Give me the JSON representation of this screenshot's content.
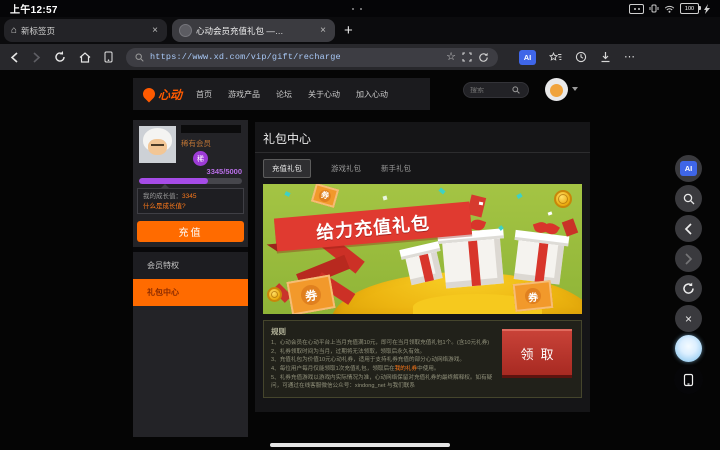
{
  "status_bar": {
    "time": "上午12:57",
    "battery": "100"
  },
  "browser": {
    "tabs": [
      {
        "title": "新标签页"
      },
      {
        "title": "心动会员充值礼包 —…"
      }
    ],
    "new_tab_label": "+",
    "url": "https://www.xd.com/vip/gift/recharge",
    "ai_label": "AI"
  },
  "site": {
    "nav": {
      "logo_text": "心动",
      "menu": [
        "首页",
        "游戏产品",
        "论坛",
        "关于心动",
        "加入心动"
      ],
      "search_placeholder": "搜索"
    },
    "sidebar": {
      "member_level": "稀有会员",
      "badge_char": "稀",
      "progress_text": "3345/5000",
      "growth_label": "我的成长值：",
      "growth_value": "3345",
      "growth_link": "什么是成长值?",
      "recharge_button": "充值",
      "menu": [
        {
          "label": "会员特权"
        },
        {
          "label": "礼包中心"
        }
      ]
    },
    "main": {
      "title": "礼包中心",
      "tabs": [
        "充值礼包",
        "游戏礼包",
        "新手礼包"
      ],
      "banner": {
        "headline": "给力充值礼包",
        "coupon_char": "券"
      },
      "rules": {
        "title": "规则",
        "item1": "1、心动会员在心动平台上当月充值满10元，即可在当月领取充值礼包1个。(含10元礼券)",
        "item2": "2、礼券领取时间为当月，过期将无法领取，领取后永久有效。",
        "item3": "3、充值礼包为价值10元心动礼券，适用于支持礼券充值的部分心动网络游戏。",
        "item4_prefix": "4、每位用户每月仅能领取1次充值礼包，领取后在",
        "item4_link": "我的礼券",
        "item4_suffix": "中使用。",
        "item5": "5、礼券充值游戏以游戏内实际情况为准，心动网络保留对充值礼券的最终解释权。如有疑问，可通过在线客服微信公众号：xindong_net 与我们联系"
      },
      "claim_button": "领取"
    }
  },
  "colors": {
    "accent_orange": "#ff6b00",
    "member_purple": "#a64ce8",
    "banner_green": "#9bbd3c",
    "claim_red": "#b53229",
    "url_blue": "#a9c9f7"
  }
}
